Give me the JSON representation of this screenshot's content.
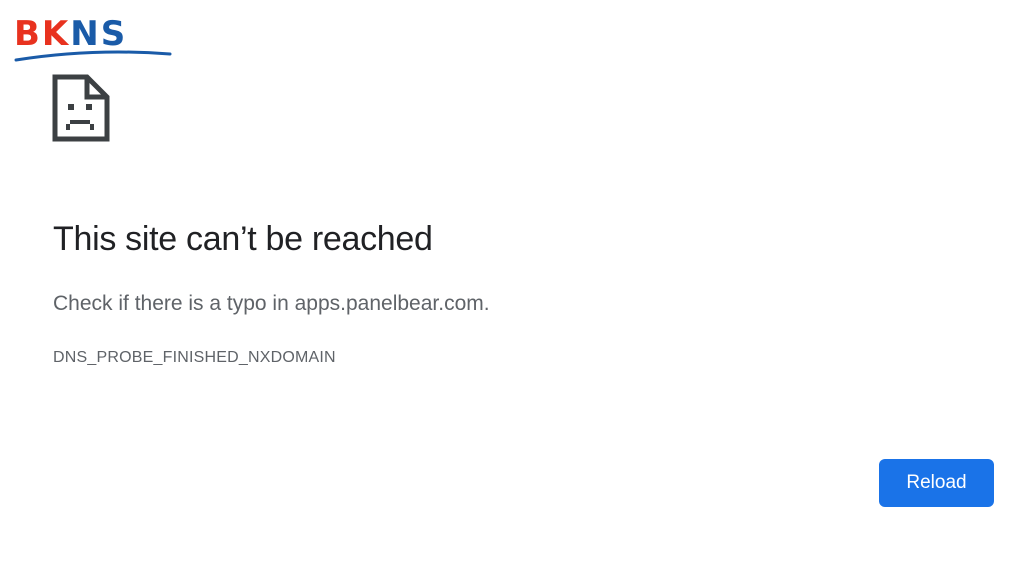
{
  "watermark": {
    "logo_text_part1": "BK",
    "logo_text_part2": "NS",
    "colors": {
      "red": "#e8321f",
      "blue": "#1a5ba8"
    }
  },
  "error_page": {
    "icon": "sad-page-icon",
    "title": "This site can’t be reached",
    "message": "Check if there is a typo in apps.panelbear.com.",
    "error_code": "DNS_PROBE_FINISHED_NXDOMAIN",
    "reload_label": "Reload"
  },
  "colors": {
    "accent": "#1a73e8",
    "title_text": "#202124",
    "secondary_text": "#5f6368",
    "icon_stroke": "#3c4043"
  }
}
